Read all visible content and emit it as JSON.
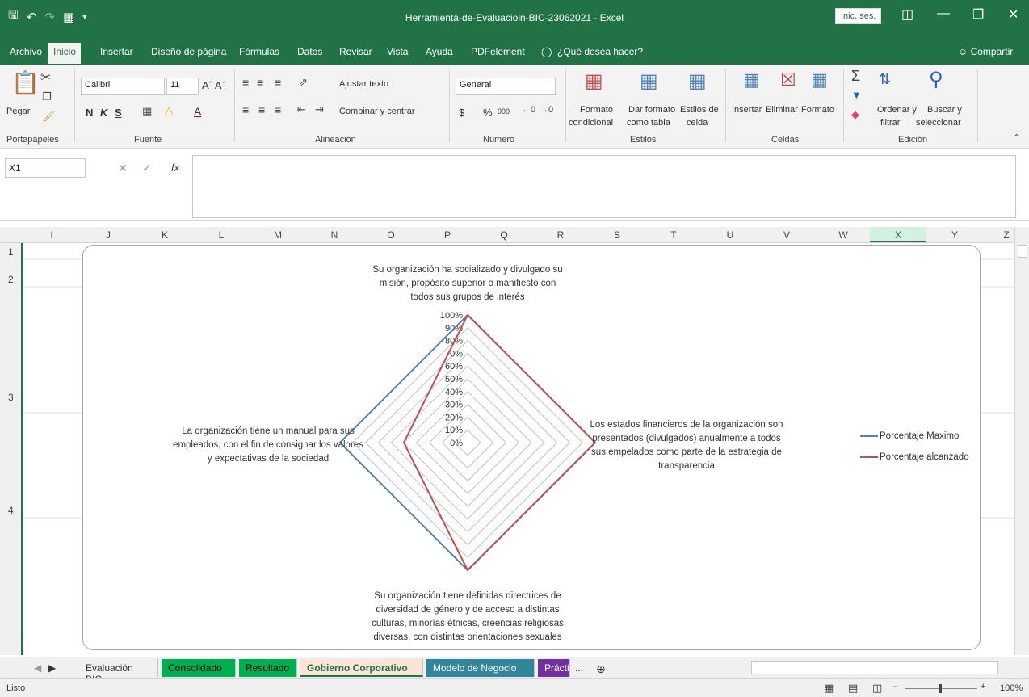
{
  "window": {
    "title": "Herramienta-de-Evaluacioln-BIC-23062021  -  Excel",
    "signin_label": "Inic. ses."
  },
  "menu": {
    "tabs": [
      "Archivo",
      "Inicio",
      "Insertar",
      "Diseño de página",
      "Fórmulas",
      "Datos",
      "Revisar",
      "Vista",
      "Ayuda",
      "PDFelement"
    ],
    "tell_me": "¿Qué desea hacer?",
    "share": "Compartir"
  },
  "ribbon": {
    "paste": "Pegar",
    "font_name": "Calibri",
    "font_size": "11",
    "bold": "N",
    "italic": "K",
    "underline": "S",
    "wrap_text": "Ajustar texto",
    "merge_center": "Combinar y centrar",
    "number_format": "General",
    "currency": "$",
    "percent": "%",
    "thousands": "000",
    "cond_format_1": "Formato",
    "cond_format_2": "condicional",
    "table_format_1": "Dar formato",
    "table_format_2": "como tabla",
    "cell_styles_1": "Estilos de",
    "cell_styles_2": "celda",
    "insert": "Insertar",
    "delete": "Eliminar",
    "format": "Formato",
    "sort_1": "Ordenar y",
    "sort_2": "filtrar",
    "find_1": "Buscar y",
    "find_2": "seleccionar",
    "groups": [
      "Portapapeles",
      "Fuente",
      "Alineación",
      "Número",
      "Estilos",
      "Celdas",
      "Edición"
    ]
  },
  "formula_bar": {
    "name_box": "X1",
    "fx": "fx",
    "formula": ""
  },
  "grid": {
    "columns": [
      "I",
      "J",
      "K",
      "L",
      "M",
      "N",
      "O",
      "P",
      "Q",
      "R",
      "S",
      "T",
      "U",
      "V",
      "W",
      "X",
      "Y",
      "Z"
    ],
    "rows": [
      "1",
      "2",
      "3",
      "4"
    ]
  },
  "chart_data": {
    "type": "radar",
    "categories": [
      "Su organización ha socializado y divulgado su misión, propósito superior o manifiesto con todos sus grupos de interés",
      "Los estados financieros de la organización son presentados (divulgados) anualmente a todos sus empelados como parte de la estrategia de transparencia",
      "Su organización tiene definidas directrices de diversidad de género y de acceso a distintas culturas, minorías étnicas, creencias religiosas diversas, con distintas orientaciones sexuales",
      "La organización tiene un manual para sus empleados, con el fin de consignar los valores y expectativas de la sociedad"
    ],
    "series": [
      {
        "name": "Porcentaje Maximo",
        "values": [
          100,
          100,
          100,
          100
        ],
        "color": "#4f81bd"
      },
      {
        "name": "Porcentaje alcanzado",
        "values": [
          100,
          100,
          100,
          50
        ],
        "color": "#c0504d"
      }
    ],
    "ticks": [
      "0%",
      "10%",
      "20%",
      "30%",
      "40%",
      "50%",
      "60%",
      "70%",
      "80%",
      "90%",
      "100%"
    ],
    "ylim": [
      0,
      100
    ],
    "legend": "right",
    "label_lines": {
      "top": [
        "Su organización ha socializado y divulgado su",
        "misión, propósito superior o manifiesto con",
        "todos sus grupos de interés"
      ],
      "right": [
        "Los estados financieros de la organización son",
        "presentados (divulgados) anualmente a todos",
        "sus empelados como parte de la estrategia de",
        "transparencia"
      ],
      "bottom": [
        "Su organización tiene definidas directrices de",
        "diversidad de género y de acceso a distintas",
        "culturas, minorías étnicas, creencias religiosas",
        "diversas, con distintas orientaciones sexuales"
      ],
      "left": [
        "La organización tiene un manual para sus",
        "empleados, con el fin de consignar los valores",
        "y expectativas de la sociedad"
      ]
    }
  },
  "sheets": {
    "tabs": [
      {
        "label": "Evaluación BIC",
        "bg": "#f0f0f0",
        "fg": "#333333"
      },
      {
        "label": "Consolidado",
        "bg": "#00b050",
        "fg": "#000000"
      },
      {
        "label": "Resultado",
        "bg": "#00b050",
        "fg": "#000000"
      },
      {
        "label": "Gobierno Corporativo",
        "bg": "#fbe4d5",
        "fg": "#217346"
      },
      {
        "label": "Modelo de Negocio",
        "bg": "#31869b",
        "fg": "#ffffff"
      },
      {
        "label": "Prácti",
        "bg": "#7030a0",
        "fg": "#ffffff"
      }
    ],
    "more": "..."
  },
  "status": {
    "ready": "Listo",
    "zoom": "100%"
  }
}
